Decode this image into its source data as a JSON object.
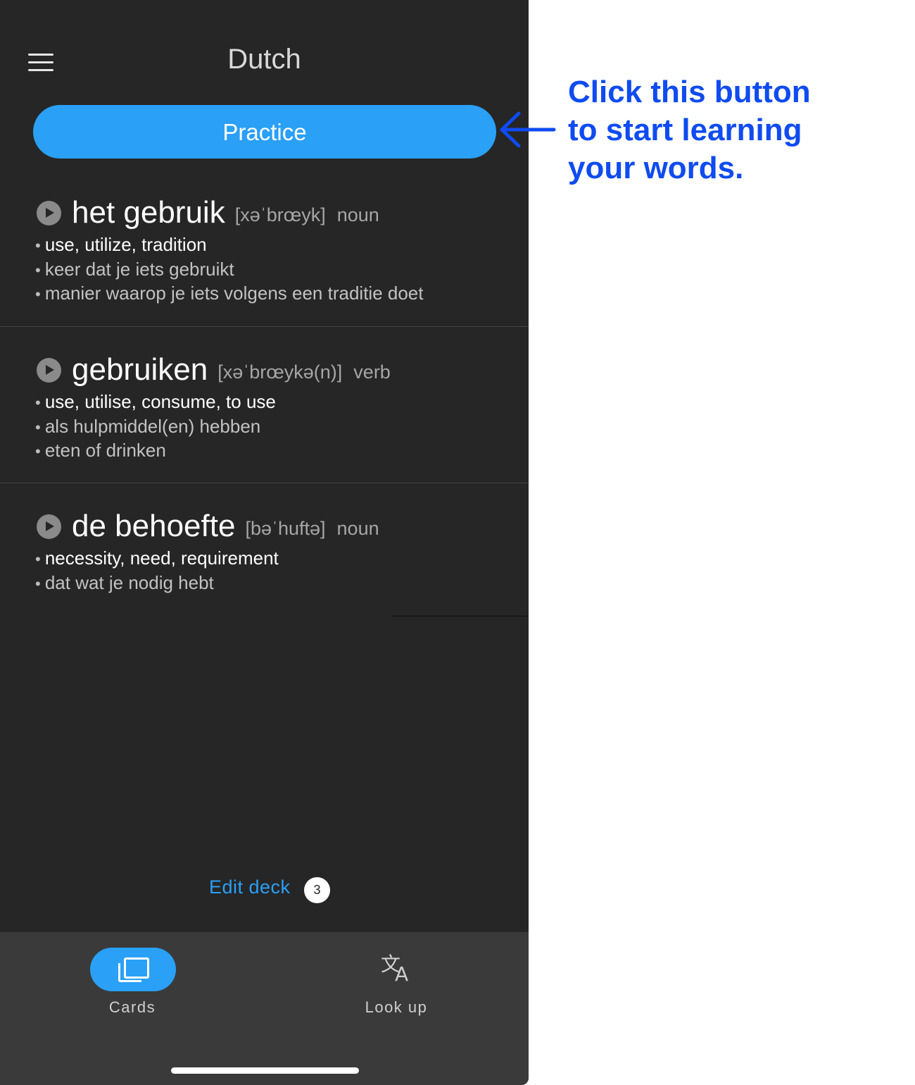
{
  "header": {
    "menu_icon": "hamburger-menu-icon",
    "title": "Dutch"
  },
  "practice_button": {
    "label": "Practice"
  },
  "words": [
    {
      "word": "het gebruik",
      "phonetic": "[xəˈbrœyk]",
      "pos": "noun",
      "definitions": [
        "use, utilize, tradition",
        "keer dat je iets gebruikt",
        "manier waarop je iets volgens een traditie doet"
      ]
    },
    {
      "word": "gebruiken",
      "phonetic": "[xəˈbrœykə(n)]",
      "pos": "verb",
      "definitions": [
        "use, utilise, consume, to use",
        "als hulpmiddel(en) hebben",
        "eten of drinken"
      ]
    },
    {
      "word": "de behoefte",
      "phonetic": "[bəˈhuftə]",
      "pos": "noun",
      "definitions": [
        "necessity, need, requirement",
        "dat wat je nodig hebt"
      ]
    }
  ],
  "edit_deck": {
    "label": "Edit deck",
    "count": "3"
  },
  "tabs": [
    {
      "label": "Cards",
      "icon": "cards-icon",
      "active": true
    },
    {
      "label": "Look up",
      "icon": "translate-icon",
      "active": false
    }
  ],
  "annotation": {
    "lines": [
      "Click this button",
      "to start learning",
      "your words."
    ],
    "color": "#0f4bf0"
  },
  "colors": {
    "background": "#262626",
    "accent": "#2aa0f7",
    "tabbar": "#3a3a3a"
  }
}
